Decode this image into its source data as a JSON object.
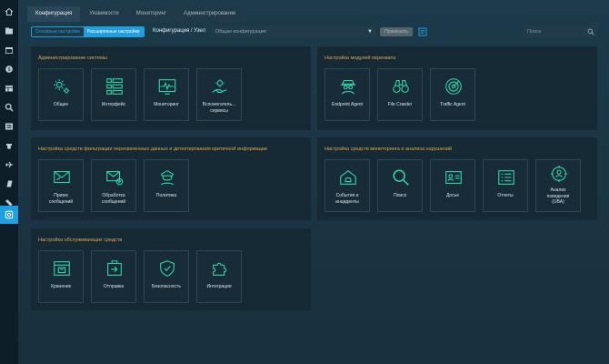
{
  "tabs": [
    "Конфигурация",
    "Уязвимости",
    "Мониторинг",
    "Администрирование"
  ],
  "toolbar": {
    "basic": "Основные настройки",
    "advanced": "Расширенные настройки",
    "breadcrumb": "Конфигурация / Узел",
    "select_value": "Общая конфигурация",
    "apply": "Применить",
    "search_placeholder": "Поиск"
  },
  "panels": {
    "admin": {
      "title": "Администрирование системы",
      "tiles": [
        "Общее",
        "Интерфейс",
        "Мониторинг",
        "Вспомогатель...\nсервисы"
      ]
    },
    "intercept": {
      "title": "Настройка модулей перехвата",
      "tiles": [
        "Endpoint Agent",
        "File Crawler",
        "Traffic Agent"
      ]
    },
    "filter": {
      "title": "Настройка средств фильтрации перехваченных данных и детектирования критичной информации",
      "tiles": [
        "Прием\nсообщений",
        "Обработка\nсообщений",
        "Политика"
      ]
    },
    "monitoring": {
      "title": "Настройка средств мониторинга и анализа нарушений",
      "tiles": [
        "События и\nинциденты",
        "Поиск",
        "Досье",
        "Отчеты",
        "Анализ\nповедения\n(UBA)"
      ]
    },
    "service": {
      "title": "Настройка обслуживающих средств",
      "tiles": [
        "Хранение",
        "Отправка",
        "Безопасность",
        "Интеграция"
      ]
    }
  },
  "colors": {
    "accent": "#1f9fe0",
    "icon": "#2fd6a6",
    "section_title": "#e0a74a"
  },
  "sidebar_icons": [
    "home-icon",
    "folder-icon",
    "calendar-icon",
    "bug-icon",
    "table-icon",
    "search-icon",
    "list-icon",
    "badge-icon",
    "plane-icon",
    "book-icon",
    "tag-icon",
    "settings-icon"
  ]
}
